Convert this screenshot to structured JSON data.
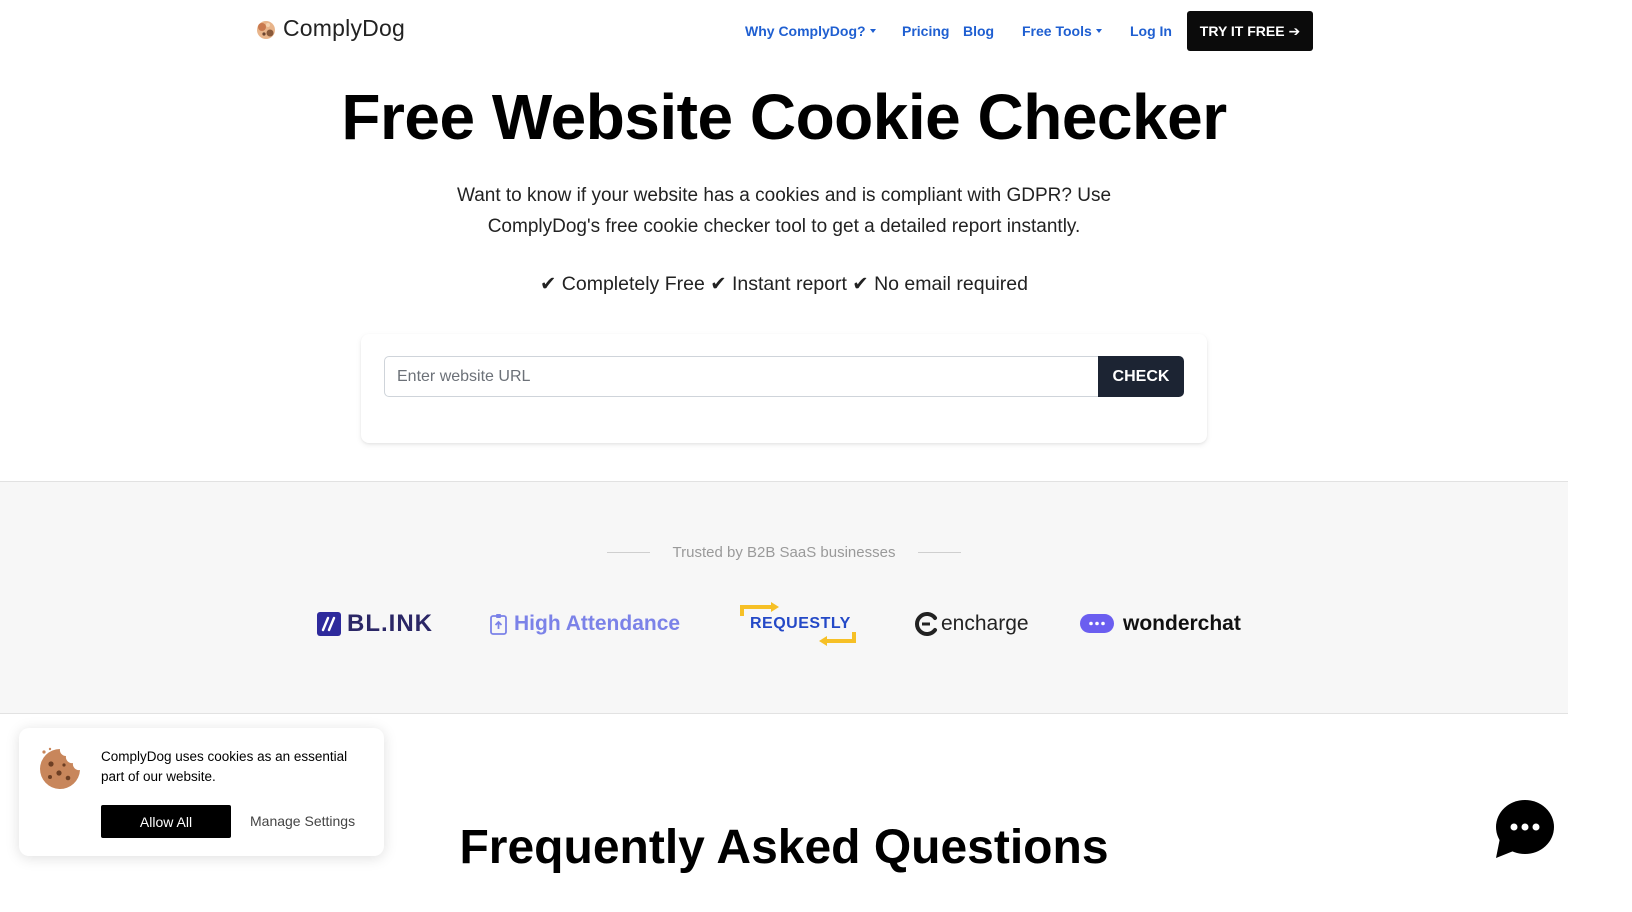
{
  "brand": {
    "name": "ComplyDog"
  },
  "nav": {
    "why": "Why ComplyDog?",
    "pricing": "Pricing",
    "blog": "Blog",
    "free_tools": "Free Tools",
    "login": "Log In",
    "cta": "TRY IT FREE ➔"
  },
  "hero": {
    "title": "Free Website Cookie Checker",
    "subtitle": "Want to know if your website has a cookies and is compliant with GDPR? Use ComplyDog's free cookie checker tool to get a detailed report instantly.",
    "features": "✔︎ Completely Free ✔︎ Instant report ✔︎ No email required"
  },
  "checker": {
    "placeholder": "Enter website URL",
    "button": "CHECK"
  },
  "trusted": {
    "label": "Trusted by B2B SaaS businesses",
    "brands": [
      "BL.INK",
      "High Attendance",
      "REQUESTLY",
      "encharge",
      "wonderchat"
    ]
  },
  "faq": {
    "title": "Frequently Asked Questions"
  },
  "cookie_banner": {
    "text": "ComplyDog uses cookies as an essential part of our website.",
    "allow": "Allow All",
    "manage": "Manage Settings"
  },
  "colors": {
    "nav_link": "#1f5fd1",
    "cta_bg": "#0b0b0b",
    "check_bg": "#1c2433",
    "trusted_bg": "#f7f7f7"
  }
}
